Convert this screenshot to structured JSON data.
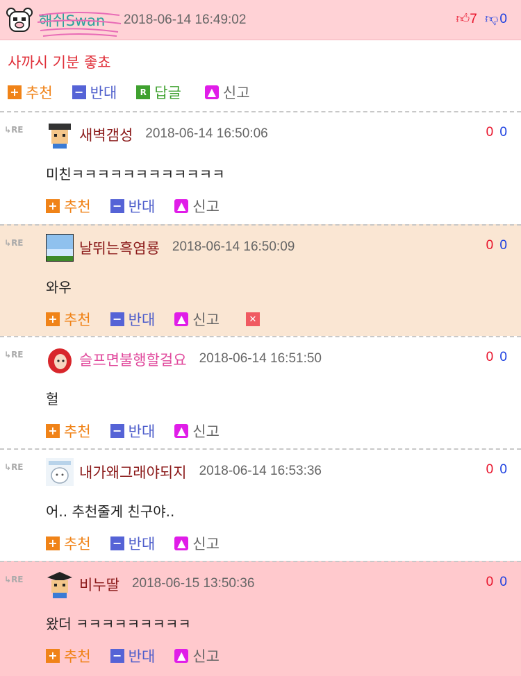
{
  "post": {
    "nick": "해쉬Swan",
    "date": "2018-06-14 16:49:02",
    "up": "7",
    "down": "0",
    "text": "사까시 기분 좋쵸",
    "actions": {
      "recommend": "추천",
      "oppose": "반대",
      "reply": "답글",
      "report": "신고"
    }
  },
  "re_label": "RE",
  "comments": [
    {
      "nick": "새벽갬성",
      "date": "2018-06-14 16:50:06",
      "up": "0",
      "down": "0",
      "text": "미친ㅋㅋㅋㅋㅋㅋㅋㅋㅋㅋㅋㅋ",
      "recommend": "추천",
      "oppose": "반대",
      "report": "신고",
      "bg": "#ffffff",
      "nick_color": "#8b1a1a"
    },
    {
      "nick": "날뛰는흑염룡",
      "date": "2018-06-14 16:50:09",
      "up": "0",
      "down": "0",
      "text": "와우",
      "recommend": "추천",
      "oppose": "반대",
      "report": "신고",
      "bg": "#fae6d3",
      "nick_color": "#8b1a1a",
      "deletable": true
    },
    {
      "nick": "슬프면불행할걸요",
      "date": "2018-06-14 16:51:50",
      "up": "0",
      "down": "0",
      "text": "헐",
      "recommend": "추천",
      "oppose": "반대",
      "report": "신고",
      "bg": "#ffffff",
      "nick_color": "#e0479b"
    },
    {
      "nick": "내가왜그래야되지",
      "date": "2018-06-14 16:53:36",
      "up": "0",
      "down": "0",
      "text": "어.. 추천줄게 친구야..",
      "recommend": "추천",
      "oppose": "반대",
      "report": "신고",
      "bg": "#ffffff",
      "nick_color": "#8b1a1a"
    },
    {
      "nick": "비누딸",
      "date": "2018-06-15 13:50:36",
      "up": "0",
      "down": "0",
      "text": "왔더 ㅋㅋㅋㅋㅋㅋㅋㅋㅋ",
      "recommend": "추천",
      "oppose": "반대",
      "report": "신고",
      "bg": "#ffc9cd",
      "nick_color": "#8b1a1a"
    }
  ],
  "colors": {
    "up": "#e8132b",
    "down": "#1b3fe0",
    "post_text": "#e0313b"
  },
  "icons": [
    "bear-avatar-icon",
    "thumbs-up-icon",
    "thumbs-down-icon",
    "reply-arrow-icon",
    "siren-icon",
    "delete-x-icon"
  ]
}
